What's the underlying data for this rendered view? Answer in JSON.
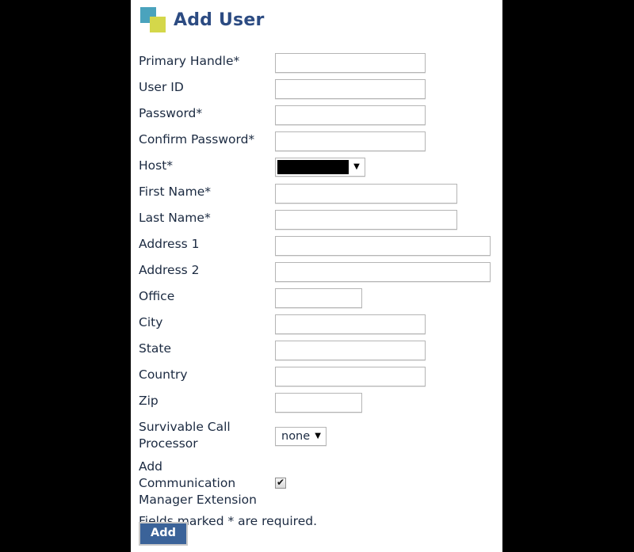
{
  "page": {
    "title": "Add User",
    "logo": {
      "icon": "two-squares-logo",
      "teal_color": "#4aa3bd",
      "yellow_color": "#d4d74a"
    },
    "title_color": "#2c4b82",
    "background_color": "#000000",
    "panel_color": "#ffffff"
  },
  "form": {
    "fields": [
      {
        "label": "Primary Handle*",
        "type": "text",
        "value": "",
        "placeholder": "",
        "width": "w-md"
      },
      {
        "label": "User ID",
        "type": "text",
        "value": "",
        "placeholder": "",
        "width": "w-md"
      },
      {
        "label": "Password*",
        "type": "password",
        "value": "",
        "placeholder": "",
        "width": "w-md"
      },
      {
        "label": "Confirm Password*",
        "type": "password",
        "value": "",
        "placeholder": "",
        "width": "w-md"
      },
      {
        "label": "Host*",
        "type": "select-redacted",
        "value": "",
        "width": "host"
      },
      {
        "label": "First Name*",
        "type": "text",
        "value": "",
        "placeholder": "",
        "width": "w-lg"
      },
      {
        "label": "Last Name*",
        "type": "text",
        "value": "",
        "placeholder": "",
        "width": "w-lg"
      },
      {
        "label": "Address 1",
        "type": "text",
        "value": "",
        "placeholder": "",
        "width": "w-xl"
      },
      {
        "label": "Address 2",
        "type": "text",
        "value": "",
        "placeholder": "",
        "width": "w-xl"
      },
      {
        "label": "Office",
        "type": "text",
        "value": "",
        "placeholder": "",
        "width": "w-sm"
      },
      {
        "label": "City",
        "type": "text",
        "value": "",
        "placeholder": "",
        "width": "w-md"
      },
      {
        "label": "State",
        "type": "text",
        "value": "",
        "placeholder": "",
        "width": "w-md"
      },
      {
        "label": "Country",
        "type": "text",
        "value": "",
        "placeholder": "",
        "width": "w-md"
      },
      {
        "label": "Zip",
        "type": "text",
        "value": "",
        "placeholder": "",
        "width": "w-sm"
      }
    ],
    "survivable_call_processor": {
      "label": "Survivable Call\nProcessor",
      "selected": "none",
      "arrow_icon": "chevron-down-icon"
    },
    "add_communication_manager_extension": {
      "label": "Add\nCommunication\nManager Extension",
      "checked": true,
      "check_icon": "check-icon",
      "check_glyph": "✔"
    },
    "required_note": "Fields marked * are required."
  },
  "footer": {
    "add_button_label": "Add",
    "add_button_color": "#3b6399"
  }
}
